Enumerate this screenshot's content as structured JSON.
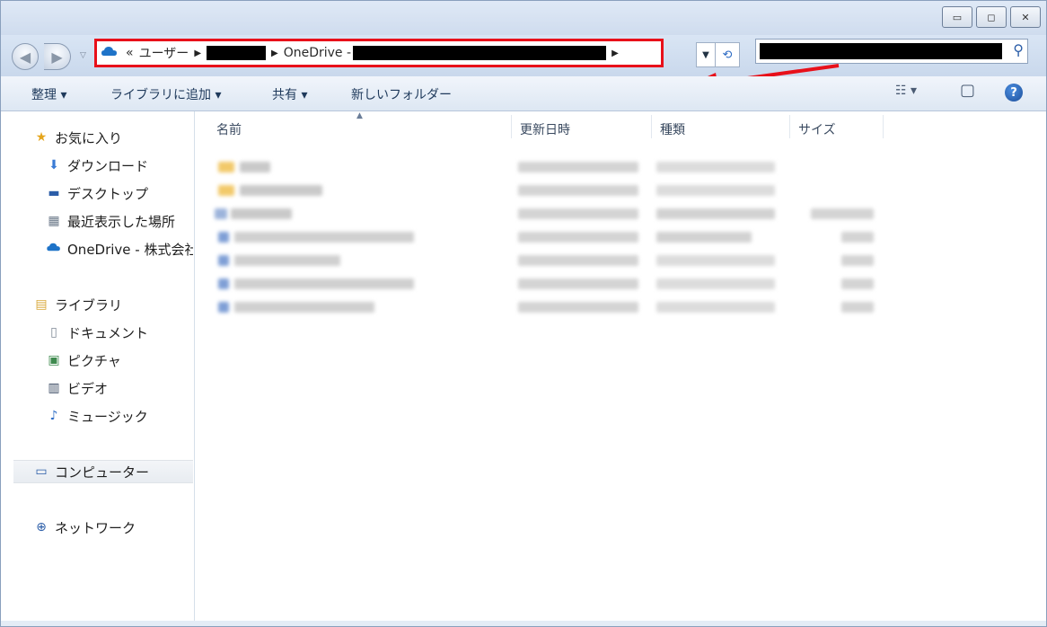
{
  "window": {
    "controls": [
      "minimize",
      "maximize",
      "close"
    ],
    "control_glyphs": [
      "▭",
      "◻",
      "✕"
    ]
  },
  "nav": {
    "back_glyph": "◀",
    "forward_glyph": "▶",
    "dropdown_glyph": "▽"
  },
  "address": {
    "icon": "onedrive-cloud-icon",
    "overflow": "«",
    "crumb1": "ユーザー",
    "crumb3": "OneDrive -",
    "separator": "▶"
  },
  "toolbar": {
    "organize": "整理 ▾",
    "add_to_library": "ライブラリに追加 ▾",
    "share": "共有 ▾",
    "new_folder": "新しいフォルダー",
    "views_glyph": "☷ ▾",
    "preview_glyph": "▢",
    "help_glyph": "?"
  },
  "sidebar": {
    "favorites": {
      "icon": "star-icon",
      "label": "お気に入り"
    },
    "fav_items": [
      {
        "icon": "downloads-icon",
        "label": "ダウンロード"
      },
      {
        "icon": "desktop-icon",
        "label": "デスクトップ"
      },
      {
        "icon": "recent-places-icon",
        "label": "最近表示した場所"
      },
      {
        "icon": "onedrive-icon",
        "label": "OneDrive - 株式会社"
      }
    ],
    "libraries": {
      "icon": "library-icon",
      "label": "ライブラリ"
    },
    "lib_items": [
      {
        "icon": "documents-icon",
        "label": "ドキュメント"
      },
      {
        "icon": "pictures-icon",
        "label": "ピクチャ"
      },
      {
        "icon": "videos-icon",
        "label": "ビデオ"
      },
      {
        "icon": "music-icon",
        "label": "ミュージック"
      }
    ],
    "computer": {
      "icon": "computer-icon",
      "label": "コンピューター"
    },
    "network": {
      "icon": "network-icon",
      "label": "ネットワーク"
    }
  },
  "columns": {
    "name": "名前",
    "modified": "更新日時",
    "type": "種類",
    "size": "サイズ"
  },
  "colors": {
    "highlight_border": "#e8101a",
    "folder": "#f2c96a",
    "file": "#7f9fd6"
  }
}
